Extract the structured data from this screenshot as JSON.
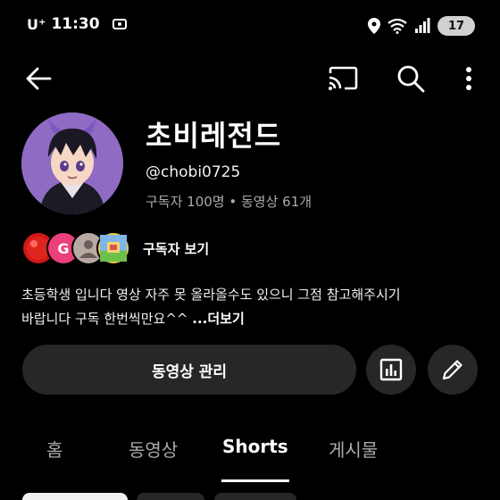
{
  "status_bar": {
    "carrier": "U⁺",
    "time": "11:30",
    "battery": "17"
  },
  "channel": {
    "name": "초비레전드",
    "handle": "@chobi0725",
    "stats": "구독자 100명 • 동영상 61개"
  },
  "subscribers": {
    "label": "구독자 보기",
    "avatar_letter": "G"
  },
  "description": {
    "line1": "초등학생 입니다 영상 자주 못 올라올수도 있으니 그점 참고해주시기",
    "line2": "바랍니다 구독 한번씩만요^^ ",
    "more": "...더보기"
  },
  "actions": {
    "manage_label": "동영상 관리",
    "analytics_icon": "analytics-icon",
    "edit_icon": "pencil-icon"
  },
  "tabs": [
    {
      "label": "홈"
    },
    {
      "label": "동영상"
    },
    {
      "label": "Shorts"
    },
    {
      "label": "게시물"
    }
  ],
  "colors": {
    "background": "#000000",
    "surface": "#272727",
    "text_secondary": "#aaaaaa",
    "avatar_bg": "#8f6bc4"
  }
}
